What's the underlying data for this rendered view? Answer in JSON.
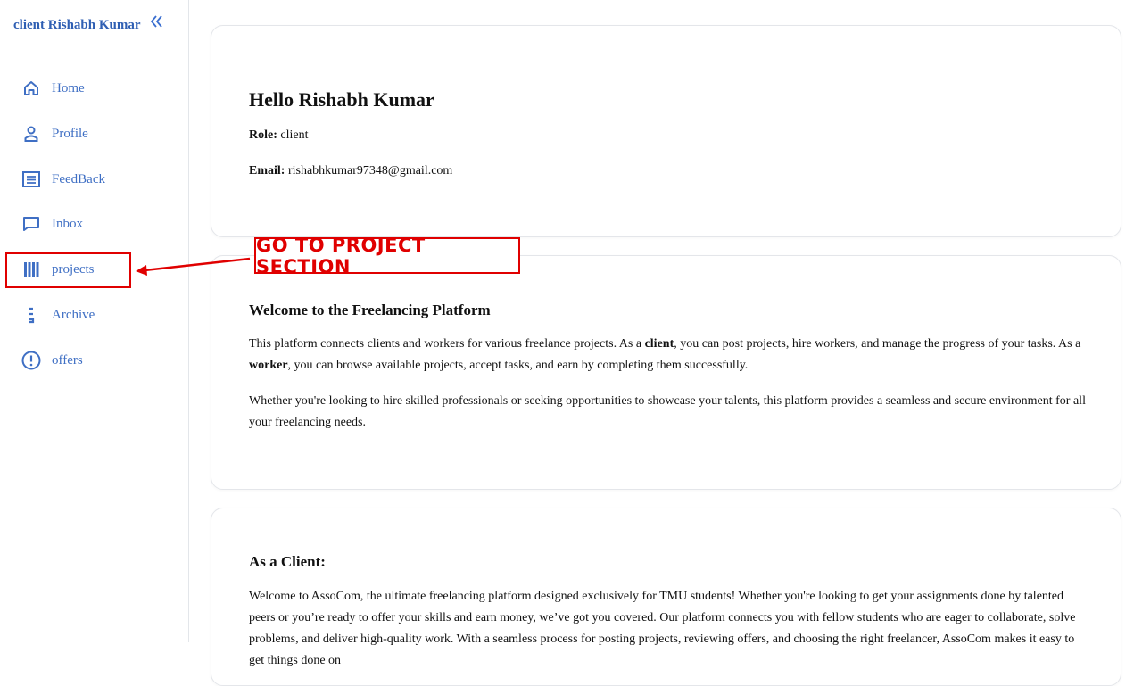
{
  "sidebar": {
    "brand": "client Rishabh Kumar",
    "collapse_icon": "double-chevron-left-icon",
    "items": [
      {
        "label": "Home",
        "icon": "home-icon"
      },
      {
        "label": "Profile",
        "icon": "user-icon"
      },
      {
        "label": "FeedBack",
        "icon": "list-icon"
      },
      {
        "label": "Inbox",
        "icon": "message-icon"
      },
      {
        "label": "projects",
        "icon": "bars-icon"
      },
      {
        "label": "Archive",
        "icon": "archive-icon"
      },
      {
        "label": "offers",
        "icon": "alert-circle-icon"
      }
    ]
  },
  "profile_card": {
    "greeting": "Hello Rishabh Kumar",
    "role_label": "Role:",
    "role_value": "client",
    "email_label": "Email:",
    "email_value": "rishabhkumar97348@gmail.com"
  },
  "welcome_card": {
    "title": "Welcome to the Freelancing Platform",
    "p1_a": "This platform connects clients and workers for various freelance projects. As a ",
    "p1_b": "client",
    "p1_c": ", you can post projects, hire workers, and manage the progress of your tasks. As a ",
    "p1_d": "worker",
    "p1_e": ", you can browse available projects, accept tasks, and earn by completing them successfully.",
    "p2": "Whether you're looking to hire skilled professionals or seeking opportunities to showcase your talents, this platform provides a seamless and secure environment for all your freelancing needs."
  },
  "client_card": {
    "title": "As a Client:",
    "p1": "Welcome to AssoCom, the ultimate freelancing platform designed exclusively for TMU students! Whether you're looking to get your assignments done by talented peers or you’re ready to offer your skills and earn money, we’ve got you covered. Our platform connects you with fellow students who are eager to collaborate, solve problems, and deliver high-quality work. With a seamless process for posting projects, reviewing offers, and choosing the right freelancer, AssoCom makes it easy to get things done on"
  },
  "annotation": {
    "label": "GO TO PROJECT SECTION",
    "color": "#e00000"
  },
  "colors": {
    "accent": "#3f6fc4",
    "brand": "#2f5fb3"
  }
}
